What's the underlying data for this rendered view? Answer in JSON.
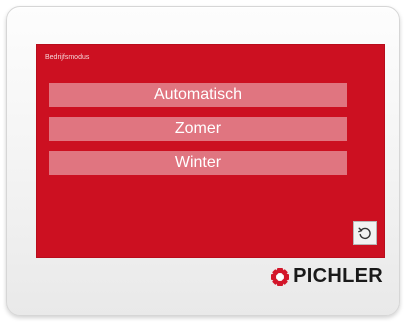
{
  "screen": {
    "title": "Bedrijfsmodus",
    "background_color": "#cc1021",
    "button_color": "#e07580",
    "modes": [
      {
        "label": "Automatisch"
      },
      {
        "label": "Zomer"
      },
      {
        "label": "Winter"
      }
    ],
    "back_button": {
      "icon": "undo-arrow-icon"
    }
  },
  "brand": {
    "name": "PICHLER",
    "logo_icon": "pichler-logo-icon",
    "logo_color": "#d3162a"
  }
}
